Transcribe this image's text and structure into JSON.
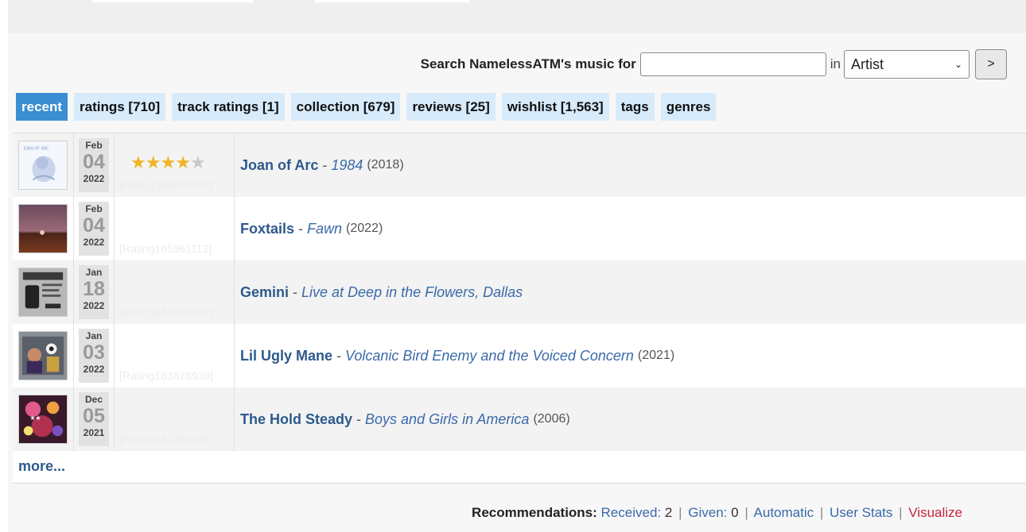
{
  "search": {
    "label": "Search NamelessATM's music for",
    "value": "",
    "placeholder": "",
    "in_label": "in",
    "field_selected": "Artist",
    "go_label": ">"
  },
  "tabs": [
    {
      "label": "recent",
      "active": true
    },
    {
      "label": "ratings [710]",
      "active": false
    },
    {
      "label": "track ratings [1]",
      "active": false
    },
    {
      "label": "collection [679]",
      "active": false
    },
    {
      "label": "reviews [25]",
      "active": false
    },
    {
      "label": "wishlist [1,563]",
      "active": false
    },
    {
      "label": "tags",
      "active": false
    },
    {
      "label": "genres",
      "active": false
    }
  ],
  "items": [
    {
      "month": "Feb",
      "day": "04",
      "year": "2022",
      "stars": 4,
      "rating_id": "[Rating165970933]",
      "artist": "Joan of Arc",
      "sep": "-",
      "album": "1984",
      "release_year": "(2018)"
    },
    {
      "month": "Feb",
      "day": "04",
      "year": "2022",
      "stars": 0,
      "rating_id": "[Rating165961112]",
      "artist": "Foxtails",
      "sep": "-",
      "album": "Fawn",
      "release_year": "(2022)"
    },
    {
      "month": "Jan",
      "day": "18",
      "year": "2022",
      "stars": 0,
      "rating_id": "[Rating164876338]",
      "artist": "Gemini",
      "sep": "-",
      "album": "Live at Deep in the Flowers, Dallas",
      "release_year": ""
    },
    {
      "month": "Jan",
      "day": "03",
      "year": "2022",
      "stars": 0,
      "rating_id": "[Rating163878939]",
      "artist": "Lil Ugly Mane",
      "sep": "-",
      "album": "Volcanic Bird Enemy and the Voiced Concern",
      "release_year": "(2021)"
    },
    {
      "month": "Dec",
      "day": "05",
      "year": "2021",
      "stars": 0,
      "rating_id": "[Rating162286535]",
      "artist": "The Hold Steady",
      "sep": "-",
      "album": "Boys and Girls in America",
      "release_year": "(2006)"
    }
  ],
  "more_label": "more...",
  "recommendations": {
    "label": "Recommendations:",
    "received_label": "Received:",
    "received_count": "2",
    "given_label": "Given:",
    "given_count": "0",
    "automatic": "Automatic",
    "user_stats": "User Stats",
    "visualize": "Visualize",
    "divider": "|"
  },
  "colors": {
    "active_tab": "#3b8ed2",
    "tab_bg": "#d7ebfb",
    "link": "#2d5a8c",
    "visualize": "#c8253c",
    "star": "#f0b429"
  }
}
